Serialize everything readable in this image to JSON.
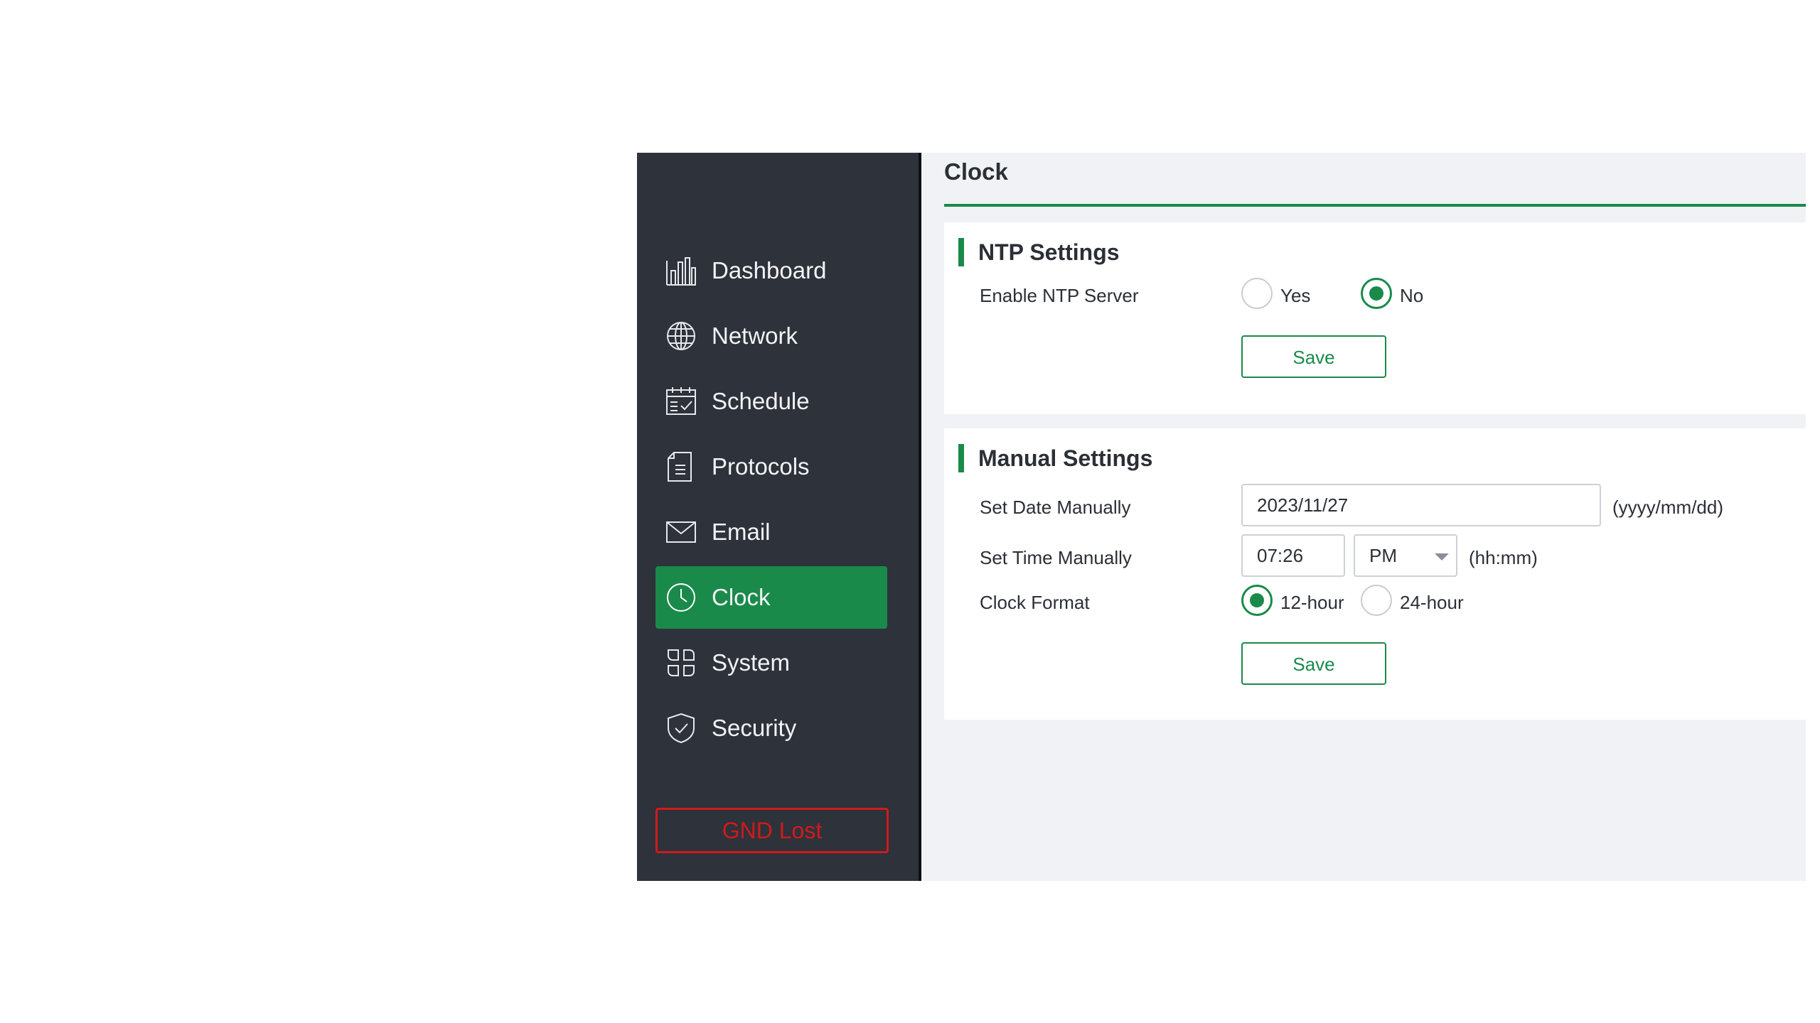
{
  "sidebar": {
    "items": [
      {
        "label": "Dashboard",
        "icon": "bar-chart-icon"
      },
      {
        "label": "Network",
        "icon": "globe-icon"
      },
      {
        "label": "Schedule",
        "icon": "calendar-check-icon"
      },
      {
        "label": "Protocols",
        "icon": "document-icon"
      },
      {
        "label": "Email",
        "icon": "envelope-icon"
      },
      {
        "label": "Clock",
        "icon": "clock-icon",
        "active": true
      },
      {
        "label": "System",
        "icon": "grid-icon"
      },
      {
        "label": "Security",
        "icon": "shield-check-icon"
      }
    ],
    "status": "GND Lost"
  },
  "page": {
    "title": "Clock"
  },
  "ntp": {
    "title": "NTP Settings",
    "enable_label": "Enable NTP Server",
    "options": [
      "Yes",
      "No"
    ],
    "selected": "No",
    "save_label": "Save"
  },
  "manual": {
    "title": "Manual Settings",
    "date_label": "Set Date Manually",
    "date_value": "2023/11/27",
    "date_hint": "(yyyy/mm/dd)",
    "time_label": "Set Time Manually",
    "time_value": "07:26",
    "ampm_value": "PM",
    "time_hint": "(hh:mm)",
    "format_label": "Clock Format",
    "format_options": [
      "12-hour",
      "24-hour"
    ],
    "format_selected": "12-hour",
    "save_label": "Save"
  },
  "colors": {
    "accent": "#1a8a4a",
    "sidebar_bg": "#2e323b",
    "alert": "#d11a1a",
    "main_bg": "#f1f2f5"
  }
}
